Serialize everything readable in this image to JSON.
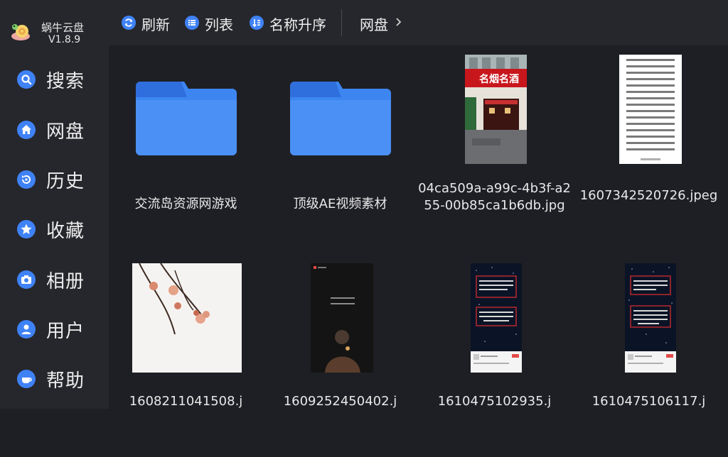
{
  "app": {
    "name": "蜗牛云盘",
    "version": "V1.8.9"
  },
  "sidebar": {
    "items": [
      {
        "label": "搜索",
        "icon": "search-icon"
      },
      {
        "label": "网盘",
        "icon": "home-icon"
      },
      {
        "label": "历史",
        "icon": "history-icon"
      },
      {
        "label": "收藏",
        "icon": "star-icon"
      },
      {
        "label": "相册",
        "icon": "camera-icon"
      },
      {
        "label": "用户",
        "icon": "user-icon"
      },
      {
        "label": "帮助",
        "icon": "help-icon"
      }
    ]
  },
  "toolbar": {
    "refresh_label": "刷新",
    "list_label": "列表",
    "sort_label": "名称升序",
    "breadcrumb": "网盘"
  },
  "colors": {
    "accent": "#3f82f6",
    "folder": "#3d86f2",
    "sidebar": "#26272c",
    "background": "#1e1f24"
  },
  "files": [
    {
      "name": "交流岛资源网游戏",
      "type": "folder"
    },
    {
      "name": "顶级AE视频素材",
      "type": "folder"
    },
    {
      "name": "04ca509a-a99c-4b3f-a255-00b85ca1b6db.jpg",
      "type": "image",
      "preview_text": "名烟名酒"
    },
    {
      "name": "1607342520726.jpeg",
      "type": "image"
    },
    {
      "name": "1608211041508.j",
      "type": "image"
    },
    {
      "name": "1609252450402.j",
      "type": "image"
    },
    {
      "name": "1610475102935.j",
      "type": "image"
    },
    {
      "name": "1610475106117.j",
      "type": "image"
    }
  ]
}
